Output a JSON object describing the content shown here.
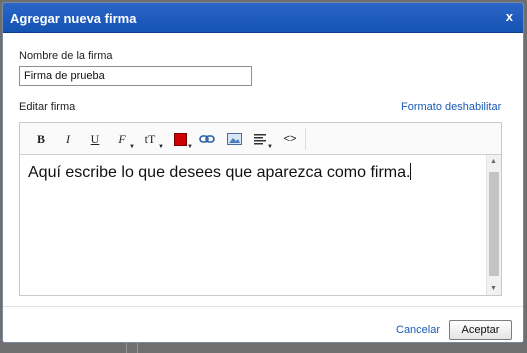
{
  "dialog": {
    "title": "Agregar nueva firma",
    "close_label": "x"
  },
  "form": {
    "name_label": "Nombre de la firma",
    "name_value": "Firma de prueba",
    "edit_label": "Editar firma",
    "format_link": "Formato deshabilitar"
  },
  "toolbar": {
    "bold": "B",
    "italic": "I",
    "underline": "U",
    "font_family": "F",
    "font_size": "tT",
    "source": "<>"
  },
  "editor": {
    "content": "Aquí escribe lo que desees que aparezca como firma."
  },
  "footer": {
    "cancel": "Cancelar",
    "accept": "Aceptar"
  },
  "colors": {
    "title_bar": "#1a5bbd",
    "link": "#1a5bb5",
    "text_color_swatch": "#cc0000"
  }
}
